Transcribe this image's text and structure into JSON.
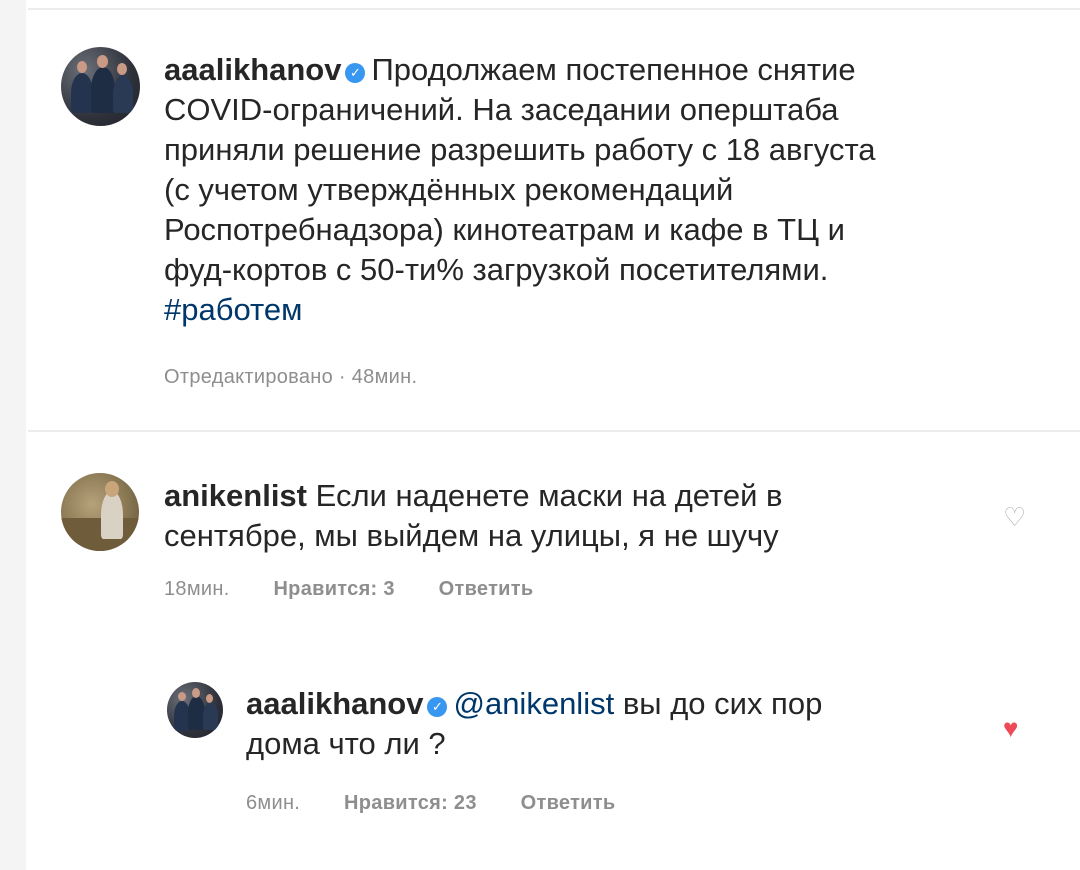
{
  "post": {
    "username": "aaalikhanov",
    "verified_icon": "verified-badge-icon",
    "caption_lines": [
      "Продолжаем постепенное снятие",
      "COVID-ограничений. На заседании оперштаба",
      "приняли решение разрешить работу с 18 августа",
      "(с учетом утверждённых рекомендаций",
      "Роспотребнадзора) кинотеатрам и кафе в ТЦ и",
      "фуд-кортов с 50-ти% загрузкой посетителями."
    ],
    "hashtag": "#работем",
    "meta": "Отредактировано · 48мин."
  },
  "comments": [
    {
      "username": "anikenlist",
      "text_line1": "Если наденете маски на детей в",
      "text_line2": "сентябре, мы выйдем на улицы, я не шучу",
      "time": "18мин.",
      "likes": "Нравится: 3",
      "reply": "Ответить",
      "heart_icon": "heart-outline-icon"
    },
    {
      "username": "aaalikhanov",
      "mention": "@anikenlist",
      "text_line1": "вы до сих пор",
      "text_line2": "дома что ли ?",
      "time": "6мин.",
      "likes": "Нравится: 23",
      "reply": "Ответить",
      "heart_icon": "heart-filled-icon"
    }
  ],
  "colors": {
    "text": "#262626",
    "meta": "#8e8e8e",
    "link": "#00376b",
    "verified": "#3897f0",
    "heart_filled": "#ed4956"
  }
}
